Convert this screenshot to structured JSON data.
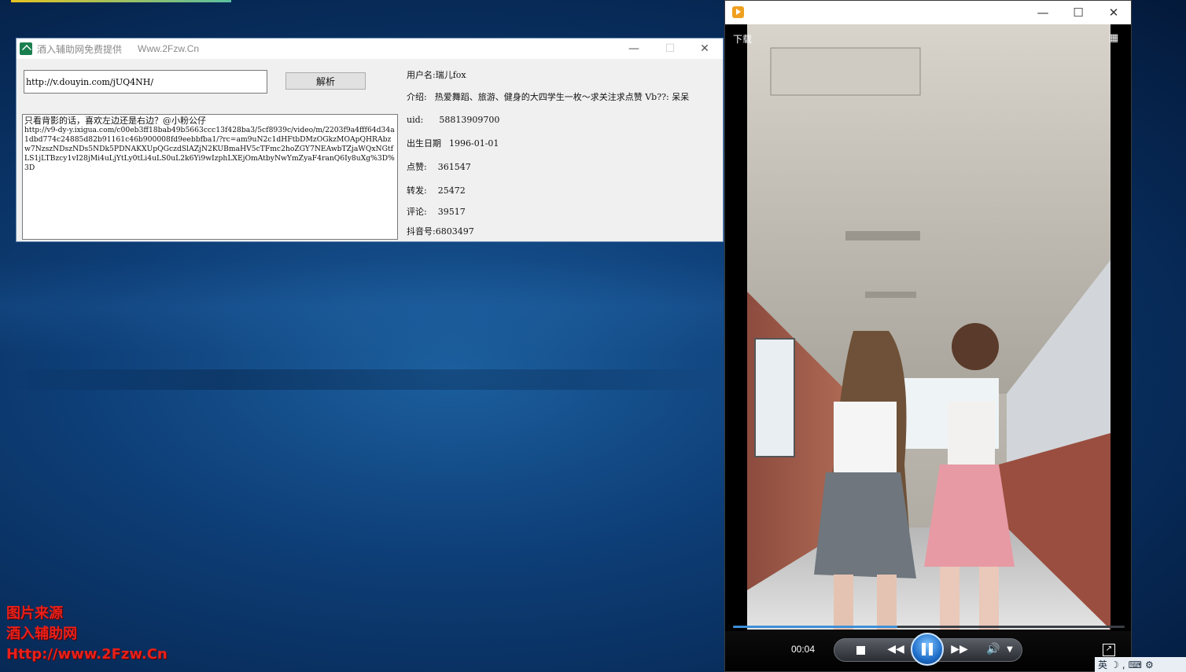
{
  "tool_window": {
    "title": "酒入辅助网免费提供",
    "site": "Www.2Fzw.Cn",
    "url_value": "http://v.douyin.com/jUQ4NH/",
    "parse_label": "解析",
    "result_line1": "只看背影的话，喜欢左边还是右边？@小粉公仔",
    "result_url": "http://v9-dy-y.ixigua.com/c00eb3ff18bab49b5663ccc13f428ba3/5cf8939c/video/m/2203f9a4fff64d34a1dbd774c24885d82b91161c46b900008fd9eebbfba1/?rc=am9uN2c1dHFtbDMzOGkzMOApQHRAbzw7NzszNDszNDs5NDk5PDNAKXUpQGczdSlAZjN2KUBmaHV5cTFmc2hoZGY7NEAwbTZjaWQxNGtfLS1jLTBzcy1vI28jMi4uLjYtLy0tLi4uLS0uL2k6Yi9wIzphLXEjOmAtbyNwYmZyaF4ranQ6Iy8uXg%3D%3D",
    "info": {
      "username_label": "用户名:",
      "username": "瑞儿fox",
      "intro_label": "介绍:",
      "intro": "热爱舞蹈、旅游、健身的大四学生一枚～求关注求点赞 Vb??: 呆呆",
      "uid_label": "uid:",
      "uid": "58813909700",
      "birth_label": "出生日期",
      "birth": "1996-01-01",
      "likes_label": "点赞:",
      "likes": "361547",
      "shares_label": "转发:",
      "shares": "25472",
      "comments_label": "评论:",
      "comments": "39517",
      "douyin_label": "抖音号:",
      "douyin": "6803497"
    }
  },
  "player": {
    "download_label": "下载",
    "time": "00:04",
    "progress": 0.42,
    "controls": [
      "stop-icon",
      "rewind-icon",
      "pause-icon",
      "fast-forward-icon",
      "volume-icon",
      "chevron-down-icon",
      "fullscreen-icon"
    ]
  },
  "watermark": {
    "line1": "图片来源",
    "line2": "酒入辅助网",
    "line3": "Http://www.2Fzw.Cn"
  },
  "tray": {
    "ime": "英"
  },
  "colors": {
    "desktop": "#0e3f78",
    "accent": "#3d8fd6",
    "watermark": "#e8201a"
  }
}
